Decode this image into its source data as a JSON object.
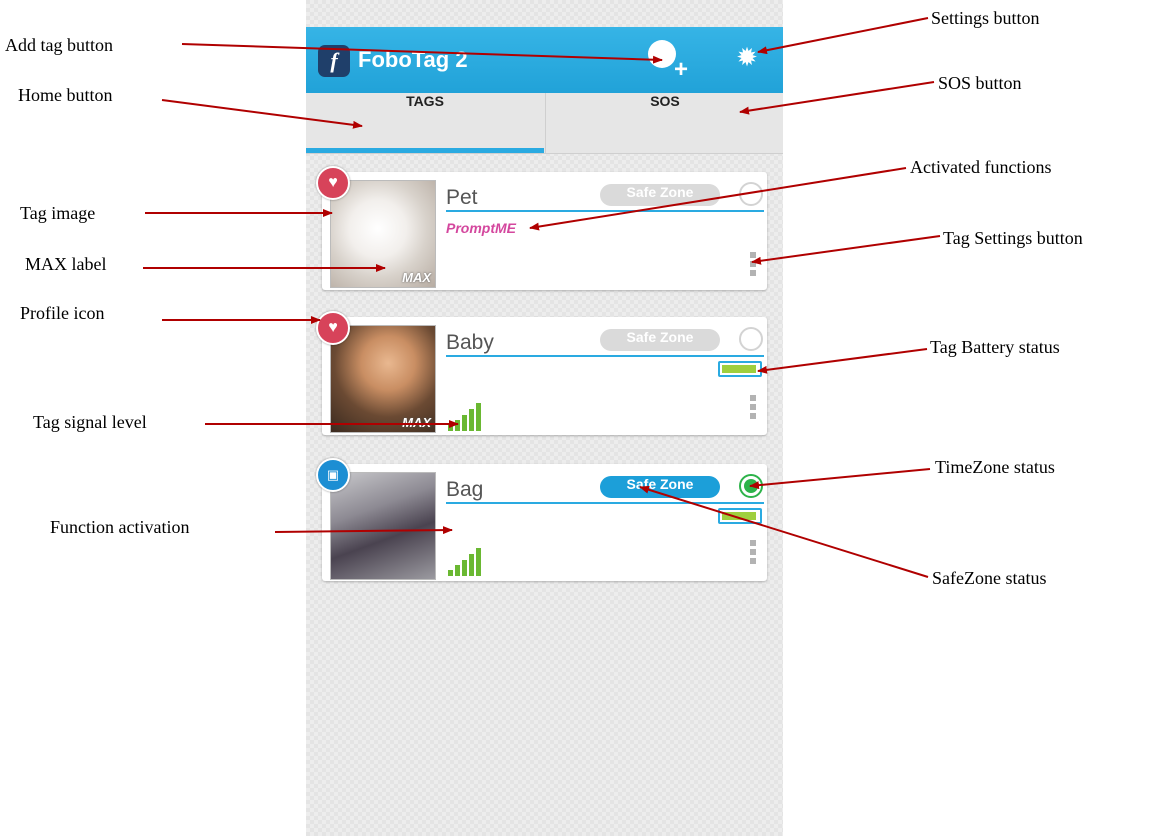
{
  "app": {
    "title": "FoboTag 2",
    "logo_letter": "f",
    "add_tag_icon": "add-tag-icon",
    "settings_icon": "gear-icon"
  },
  "tabs": [
    {
      "label": "TAGS",
      "active": true
    },
    {
      "label": "SOS",
      "active": false
    }
  ],
  "tags": [
    {
      "name": "Pet",
      "safe_zone": "Safe Zone",
      "safe_zone_active": false,
      "timezone_active": false,
      "function": "PromptME",
      "max": "MAX",
      "profile_icon": "heart-icon",
      "battery": false,
      "signal_bars": 0,
      "photo": "dog"
    },
    {
      "name": "Baby",
      "safe_zone": "Safe Zone",
      "safe_zone_active": false,
      "timezone_active": false,
      "function": "",
      "max": "MAX",
      "profile_icon": "heart-icon",
      "battery": true,
      "signal_bars": 5,
      "photo": "baby"
    },
    {
      "name": "Bag",
      "safe_zone": "Safe Zone",
      "safe_zone_active": true,
      "timezone_active": true,
      "function": "",
      "max": "",
      "profile_icon": "briefcase-icon",
      "battery": true,
      "signal_bars": 5,
      "photo": "bag"
    }
  ],
  "callouts": {
    "add_tag": "Add tag button",
    "settings": "Settings button",
    "home": "Home button",
    "sos": "SOS button",
    "activated_functions": "Activated functions",
    "tag_image": "Tag image",
    "tag_settings": "Tag Settings button",
    "max_label": "MAX label",
    "profile_icon": "Profile icon",
    "tag_battery": "Tag Battery status",
    "tag_signal": "Tag signal level",
    "timezone": "TimeZone status",
    "function_activation": "Function activation",
    "safezone": "SafeZone status"
  },
  "colors": {
    "app_bar": "#21a2d8",
    "accent": "#2aaae1",
    "safe_zone_on": "#1c9fd9",
    "heart_badge": "#d7435a",
    "function_text": "#d4479e",
    "signal": "#6ab832",
    "arrow": "#b00000"
  }
}
